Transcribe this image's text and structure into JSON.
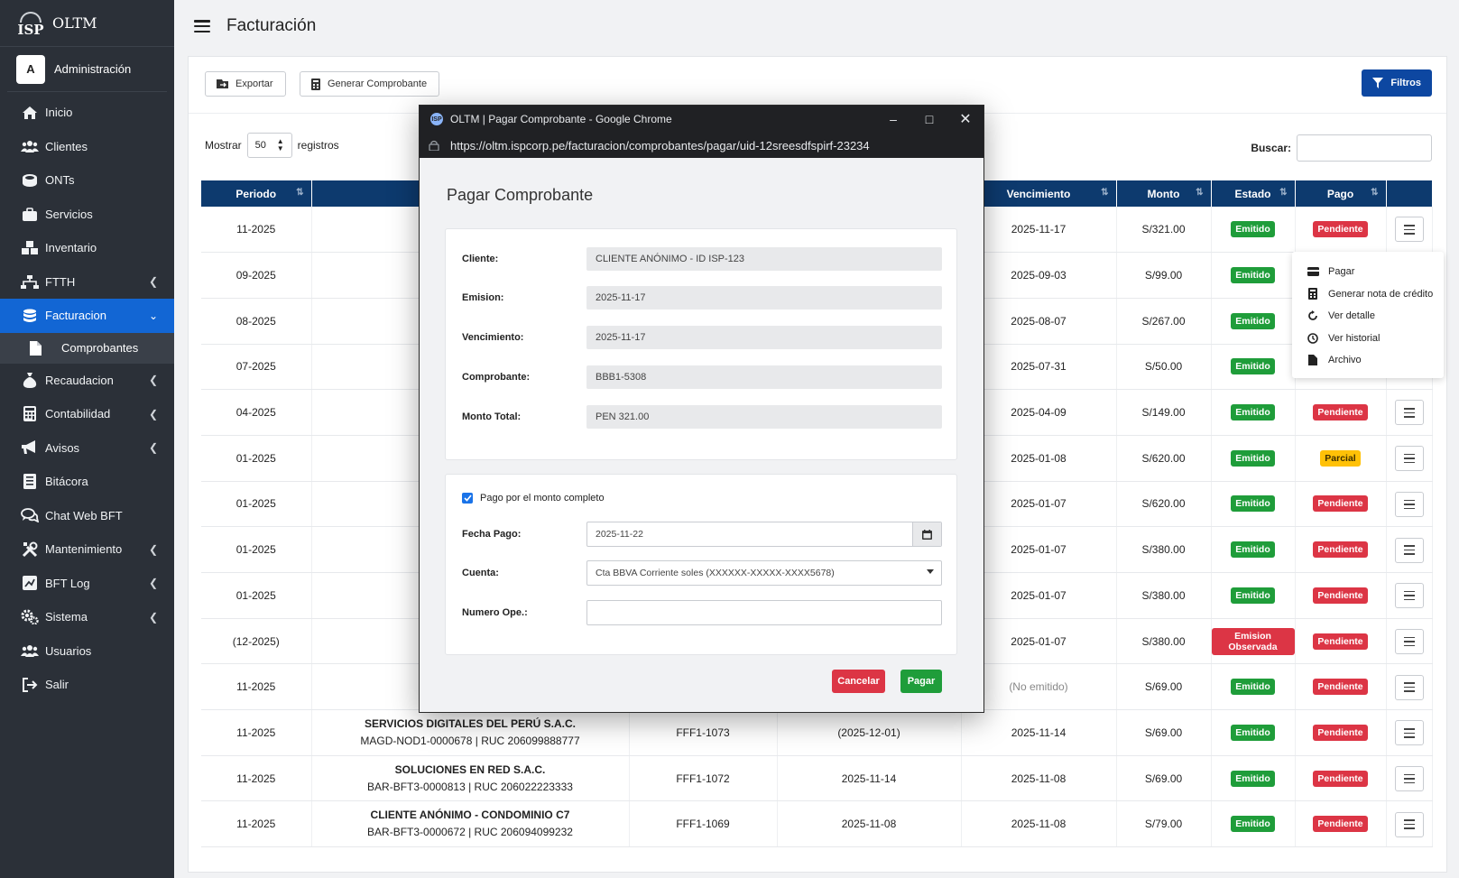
{
  "app": {
    "logo_text": "ISP",
    "name": "OLTM"
  },
  "user": {
    "avatar_letter": "A",
    "role": "Administración"
  },
  "sidebar": {
    "items": [
      {
        "label": "Inicio",
        "icon": "home-icon"
      },
      {
        "label": "Clientes",
        "icon": "users-icon"
      },
      {
        "label": "ONTs",
        "icon": "router-icon"
      },
      {
        "label": "Servicios",
        "icon": "briefcase-icon"
      },
      {
        "label": "Inventario",
        "icon": "boxes-icon"
      },
      {
        "label": "FTTH",
        "icon": "sitemap-icon"
      },
      {
        "label": "Facturacion",
        "icon": "database-icon"
      },
      {
        "label": "Comprobantes",
        "icon": "file-icon"
      },
      {
        "label": "Recaudacion",
        "icon": "money-bag-icon"
      },
      {
        "label": "Contabilidad",
        "icon": "calculator-icon"
      },
      {
        "label": "Avisos",
        "icon": "megaphone-icon"
      },
      {
        "label": "Bitácora",
        "icon": "book-icon"
      },
      {
        "label": "Chat Web BFT",
        "icon": "chat-icon"
      },
      {
        "label": "Mantenimiento",
        "icon": "tools-icon"
      },
      {
        "label": "BFT Log",
        "icon": "log-icon"
      },
      {
        "label": "Sistema",
        "icon": "cogs-icon"
      },
      {
        "label": "Usuarios",
        "icon": "user-group-icon"
      },
      {
        "label": "Salir",
        "icon": "logout-icon"
      }
    ]
  },
  "header": {
    "title": "Facturación"
  },
  "toolbar": {
    "export_label": "Exportar",
    "generate_label": "Generar Comprobante",
    "filter_label": "Filtros",
    "show_label": "Mostrar",
    "page_size": "50",
    "records_label": "registros",
    "search_label": "Buscar:",
    "search_value": ""
  },
  "table": {
    "columns": [
      "Periodo",
      "",
      "",
      "",
      "Vencimiento",
      "Monto",
      "Estado",
      "Pago",
      ""
    ],
    "rows": [
      {
        "periodo": "11-2025",
        "cliente": "",
        "detalle": "",
        "comprobante": "",
        "emision": "",
        "vencimiento": "2025-11-17",
        "monto": "S/321.00",
        "estado": "Emitido",
        "pago": "Pendiente"
      },
      {
        "periodo": "09-2025",
        "cliente": "",
        "detalle": "",
        "comprobante": "",
        "emision": "",
        "vencimiento": "2025-09-03",
        "monto": "S/99.00",
        "estado": "Emitido",
        "pago": ""
      },
      {
        "periodo": "08-2025",
        "cliente": "",
        "detalle": "",
        "comprobante": "",
        "emision": "",
        "vencimiento": "2025-08-07",
        "monto": "S/267.00",
        "estado": "Emitido",
        "pago": ""
      },
      {
        "periodo": "07-2025",
        "cliente": "",
        "detalle": "",
        "comprobante": "",
        "emision": "",
        "vencimiento": "2025-07-31",
        "monto": "S/50.00",
        "estado": "Emitido",
        "pago": ""
      },
      {
        "periodo": "04-2025",
        "cliente": "",
        "detalle": "",
        "comprobante": "",
        "emision": "",
        "vencimiento": "2025-04-09",
        "monto": "S/149.00",
        "estado": "Emitido",
        "pago": "Pendiente"
      },
      {
        "periodo": "01-2025",
        "cliente": "",
        "detalle": "",
        "comprobante": "",
        "emision": "",
        "vencimiento": "2025-01-08",
        "monto": "S/620.00",
        "estado": "Emitido",
        "pago": "Parcial"
      },
      {
        "periodo": "01-2025",
        "cliente": "",
        "detalle": "",
        "comprobante": "",
        "emision": "",
        "vencimiento": "2025-01-07",
        "monto": "S/620.00",
        "estado": "Emitido",
        "pago": "Pendiente"
      },
      {
        "periodo": "01-2025",
        "cliente": "",
        "detalle": "",
        "comprobante": "",
        "emision": "",
        "vencimiento": "2025-01-07",
        "monto": "S/380.00",
        "estado": "Emitido",
        "pago": "Pendiente"
      },
      {
        "periodo": "01-2025",
        "cliente": "",
        "detalle": "",
        "comprobante": "",
        "emision": "",
        "vencimiento": "2025-01-07",
        "monto": "S/380.00",
        "estado": "Emitido",
        "pago": "Pendiente"
      },
      {
        "periodo": "(12-2025)",
        "cliente": "",
        "detalle": "",
        "comprobante": "",
        "emision": "",
        "vencimiento": "2025-01-07",
        "monto": "S/380.00",
        "estado": "Emision Observada",
        "pago": "Pendiente"
      },
      {
        "periodo": "11-2025",
        "cliente": "",
        "detalle": "",
        "comprobante": "",
        "emision": "",
        "vencimiento": "(No emitido)",
        "monto": "S/69.00",
        "estado": "Emitido",
        "pago": "Pendiente"
      },
      {
        "periodo": "11-2025",
        "cliente": "SERVICIOS DIGITALES DEL PERÚ S.A.C.",
        "detalle": "MAGD-NOD1-0000678 | RUC 206099888777",
        "comprobante": "FFF1-1073",
        "emision": "(2025-12-01)",
        "vencimiento": "2025-11-14",
        "monto": "S/69.00",
        "estado": "Emitido",
        "pago": "Pendiente"
      },
      {
        "periodo": "11-2025",
        "cliente": "SOLUCIONES EN RED S.A.C.",
        "detalle": "BAR-BFT3-0000813 | RUC 206022223333",
        "comprobante": "FFF1-1072",
        "emision": "2025-11-14",
        "vencimiento": "2025-11-08",
        "monto": "S/69.00",
        "estado": "Emitido",
        "pago": "Pendiente"
      },
      {
        "periodo": "11-2025",
        "cliente": "CLIENTE ANÓNIMO - CONDOMINIO C7",
        "detalle": "BAR-BFT3-0000672 | RUC 206094099232",
        "comprobante": "FFF1-1069",
        "emision": "2025-11-08",
        "vencimiento": "2025-11-08",
        "monto": "S/79.00",
        "estado": "Emitido",
        "pago": "Pendiente"
      }
    ]
  },
  "dropdown": {
    "items": [
      {
        "label": "Pagar",
        "icon": "credit-card-icon"
      },
      {
        "label": "Generar nota de crédito",
        "icon": "calculator-icon"
      },
      {
        "label": "Ver detalle",
        "icon": "refresh-icon"
      },
      {
        "label": "Ver historial",
        "icon": "history-icon"
      },
      {
        "label": "Archivo",
        "icon": "file-icon"
      }
    ]
  },
  "popup": {
    "window_title": "OLTM | Pagar Comprobante - Google Chrome",
    "url": "https://oltm.ispcorp.pe/facturacion/comprobantes/pagar/uid-12sreesdfspirf-23234",
    "title": "Pagar Comprobante",
    "fields": {
      "cliente_label": "Cliente:",
      "cliente_value": "CLIENTE ANÓNIMO - ID ISP-123",
      "emision_label": "Emision:",
      "emision_value": "2025-11-17",
      "vencimiento_label": "Vencimiento:",
      "vencimiento_value": "2025-11-17",
      "comprobante_label": "Comprobante:",
      "comprobante_value": "BBB1-5308",
      "monto_label": "Monto Total:",
      "monto_value": "PEN 321.00"
    },
    "payment": {
      "full_amount_label": "Pago por el monto completo",
      "full_amount_checked": true,
      "fecha_label": "Fecha Pago:",
      "fecha_value": "2025-11-22",
      "cuenta_label": "Cuenta:",
      "cuenta_value": "Cta BBVA Corriente soles (XXXXXX-XXXXX-XXXX5678)",
      "numero_label": "Numero Ope.:",
      "numero_value": ""
    },
    "cancel_label": "Cancelar",
    "pay_label": "Pagar"
  },
  "colors": {
    "sidebar": "#2b3038",
    "active": "#1266d4",
    "header": "#0d3a6e",
    "green": "#1f9d3a",
    "red": "#dc3545",
    "yellow": "#ffc107"
  }
}
